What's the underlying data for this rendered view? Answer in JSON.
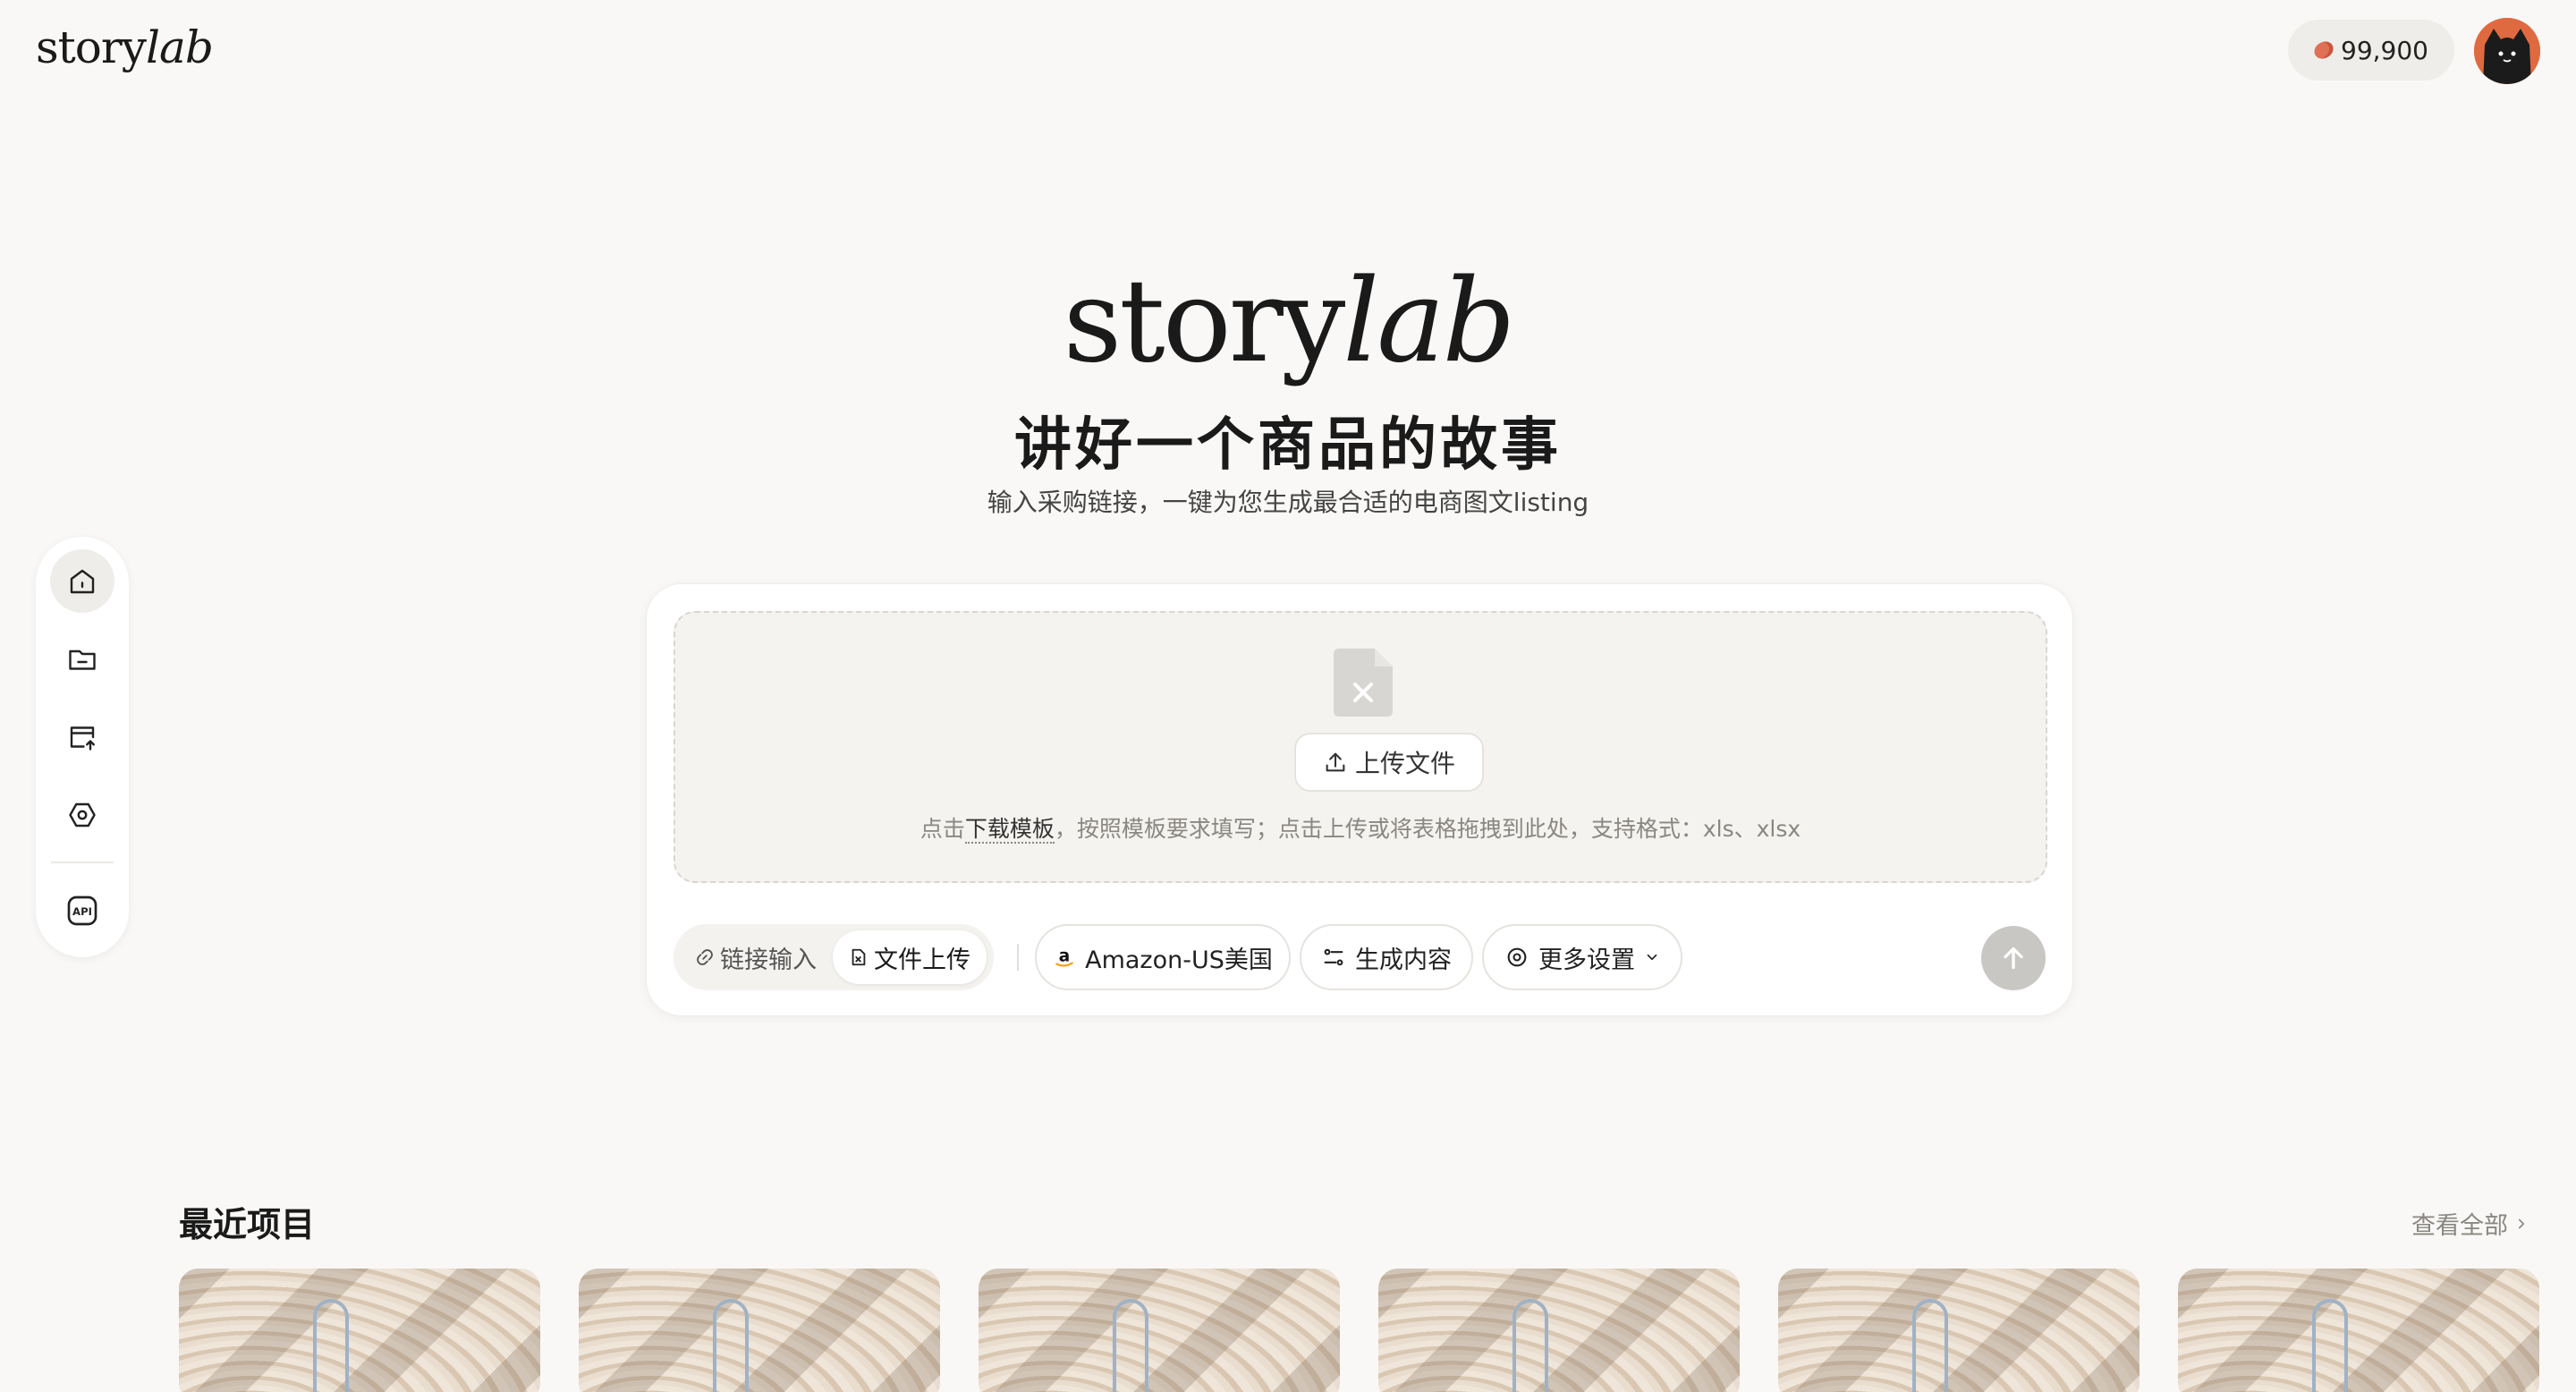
{
  "header": {
    "logo_regular": "story",
    "logo_italic": "lab",
    "credits": "99,900"
  },
  "sidebar": {
    "items": [
      {
        "name": "home",
        "icon": "home-icon",
        "active": true
      },
      {
        "name": "folder",
        "icon": "folder-icon"
      },
      {
        "name": "upload",
        "icon": "upload-box-icon"
      },
      {
        "name": "settings",
        "icon": "hex-gear-icon"
      },
      {
        "name": "api",
        "icon": "api-icon",
        "label": "API"
      }
    ]
  },
  "hero": {
    "logo_regular": "story",
    "logo_italic": "lab",
    "title": "讲好一个商品的故事",
    "subtitle": "输入采购链接，一键为您生成最合适的电商图文listing"
  },
  "upload": {
    "button_label": "上传文件",
    "hint_prefix": "点击",
    "hint_link": "下载模板",
    "hint_suffix": "，按照模板要求填写；点击上传或将表格拖拽到此处，支持格式：xls、xlsx"
  },
  "toolbar": {
    "tab_link": "链接输入",
    "tab_file": "文件上传",
    "marketplace": "Amazon-US美国",
    "generate": "生成内容",
    "more": "更多设置"
  },
  "recent": {
    "title": "最近项目",
    "view_all": "查看全部"
  },
  "colors": {
    "background": "#f9f8f6",
    "card": "#ffffff",
    "accent_bean": "#e07055",
    "send_disabled": "#c9c7c4"
  }
}
